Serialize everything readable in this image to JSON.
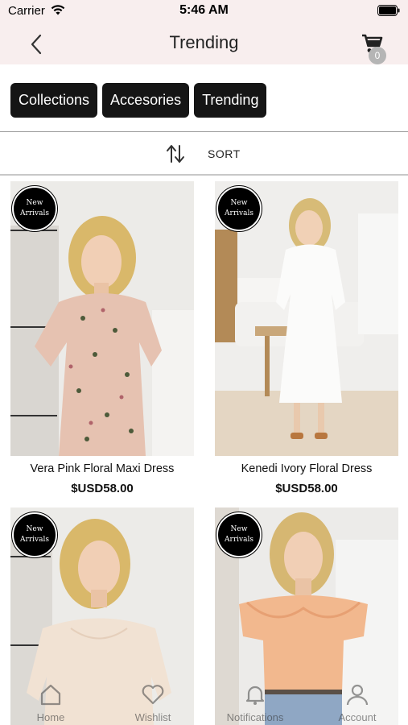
{
  "status_bar": {
    "carrier": "Carrier",
    "time": "5:46 AM"
  },
  "nav": {
    "title": "Trending",
    "cart_count": "0"
  },
  "chips": [
    {
      "label": "Collections"
    },
    {
      "label": "Accesories"
    },
    {
      "label": "Trending"
    }
  ],
  "sort": {
    "label": "SORT"
  },
  "badge": {
    "line1": "New",
    "line2": "Arrivals"
  },
  "products": [
    {
      "name": "Vera Pink Floral Maxi Dress",
      "price": "$USD58.00"
    },
    {
      "name": "Kenedi Ivory Floral Dress",
      "price": "$USD58.00"
    },
    {
      "name": "",
      "price": ""
    },
    {
      "name": "",
      "price": ""
    }
  ],
  "tabbar": {
    "items": [
      {
        "label": "Home"
      },
      {
        "label": "Wishlist"
      },
      {
        "label": "Notifications"
      },
      {
        "label": "Account"
      }
    ]
  },
  "colors": {
    "header_bg": "#f8eeee",
    "chip_bg": "#151515",
    "badge_bg": "#000000"
  }
}
